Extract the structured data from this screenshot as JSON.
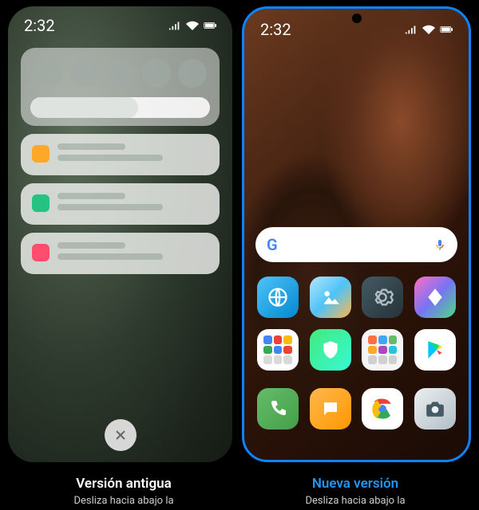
{
  "status_time": "2:32",
  "old": {
    "caption_title": "Versión antigua",
    "caption_sub": "Desliza hacia abajo la"
  },
  "new": {
    "caption_title": "Nueva versión",
    "caption_sub": "Desliza hacia abajo la",
    "search_placeholder": "G",
    "apps_row1": [
      "browser",
      "gallery",
      "settings",
      "themes"
    ],
    "apps_row2": [
      "google",
      "security",
      "tools",
      "play"
    ],
    "dock": [
      "dial",
      "sms",
      "chrome",
      "camera"
    ]
  },
  "colors": {
    "accent_new": "#0a84ff",
    "accent_title_new": "#2196f3"
  }
}
